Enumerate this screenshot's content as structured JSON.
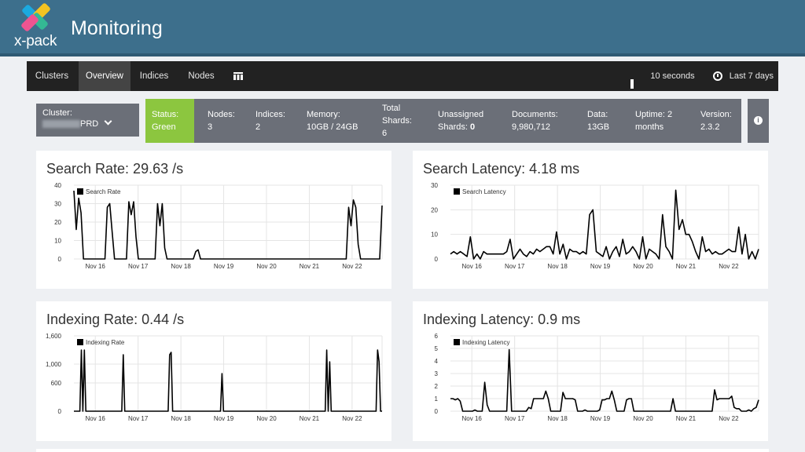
{
  "banner": {
    "title": "Monitoring",
    "logo_text": "x-pack",
    "logo_icon": "xpack-logo-icon",
    "bg_color": "#3d6f8c"
  },
  "nav": {
    "tabs": [
      {
        "label": "Clusters",
        "active": false
      },
      {
        "label": "Overview",
        "active": true
      },
      {
        "label": "Indices",
        "active": false
      },
      {
        "label": "Nodes",
        "active": false
      },
      {
        "label": "",
        "icon": "grid-icon",
        "active": false
      }
    ],
    "refresh_label": "10 seconds",
    "time_range_label": "Last 7 days"
  },
  "cluster": {
    "label": "Cluster:",
    "name_suffix": "PRD"
  },
  "status": {
    "status_label": "Status:",
    "status_value": "Green",
    "status_color": "#8cc63f",
    "nodes_label": "Nodes:",
    "nodes_value": "3",
    "indices_label": "Indices:",
    "indices_value": "2",
    "memory_label": "Memory:",
    "memory_value": "10GB / 24GB",
    "shards_label_1": "Total",
    "shards_label_2": "Shards:",
    "shards_value": "6",
    "unassigned_label": "Unassigned",
    "unassigned_label_2": "Shards:",
    "unassigned_value": "0",
    "documents_label": "Documents:",
    "documents_value": "9,980,712",
    "data_label": "Data:",
    "data_value": "13GB",
    "uptime_label": "Uptime: 2",
    "uptime_value": "months",
    "version_label": "Version:",
    "version_value": "2.3.2"
  },
  "chart_data": [
    {
      "type": "line",
      "title": "Search Rate: 29.63 /s",
      "series": [
        {
          "name": "Search Rate",
          "values": [
            37,
            16,
            33,
            25,
            0,
            0,
            0,
            0,
            0,
            0,
            0,
            0,
            0,
            0,
            28,
            30,
            15,
            0,
            0,
            0,
            0,
            0,
            0,
            31,
            24,
            31,
            12,
            0,
            0,
            0,
            0,
            0,
            0,
            0,
            0,
            30,
            18,
            30,
            6,
            0,
            0,
            0,
            0,
            0,
            0,
            0,
            0,
            0,
            0,
            0,
            0,
            4,
            5,
            0,
            0,
            0,
            0,
            0,
            0,
            0,
            0,
            0,
            0,
            0,
            0,
            0,
            0,
            0,
            0,
            0,
            0,
            0,
            0,
            0,
            0,
            0,
            0,
            0,
            0,
            0,
            0,
            0,
            0,
            0,
            0,
            0,
            0,
            0,
            0,
            0,
            0,
            0,
            0,
            0,
            0,
            0,
            0,
            0,
            0,
            0,
            0,
            0,
            0,
            0,
            0,
            0,
            0,
            0,
            0,
            0,
            0,
            0,
            0,
            0,
            0,
            28,
            18,
            32,
            28,
            8,
            0,
            0,
            0,
            0,
            0,
            0,
            0,
            0,
            0,
            29
          ]
        }
      ],
      "x_labels": [
        "Nov 16",
        "Nov 17",
        "Nov 18",
        "Nov 19",
        "Nov 20",
        "Nov 21",
        "Nov 22"
      ],
      "yticks": [
        "0",
        "10",
        "20",
        "30",
        "40"
      ],
      "ylim": [
        0,
        40
      ],
      "legend": "top-left"
    },
    {
      "type": "line",
      "title": "Search Latency: 4.18 ms",
      "series": [
        {
          "name": "Search Latency",
          "values": [
            2,
            3,
            2,
            3,
            2,
            1,
            9,
            0,
            2,
            0,
            3,
            2,
            2,
            2,
            2,
            2,
            2,
            3,
            8,
            0,
            2,
            4,
            2,
            1,
            3,
            2,
            4,
            3,
            4,
            5,
            5,
            2,
            11,
            2,
            6,
            0,
            4,
            3,
            3,
            2,
            3,
            2,
            18,
            20,
            3,
            2,
            1,
            5,
            0,
            3,
            5,
            1,
            8,
            2,
            3,
            5,
            3,
            0,
            9,
            0,
            4,
            3,
            2,
            0,
            18,
            5,
            3,
            0,
            28,
            12,
            16,
            10,
            10,
            7,
            3,
            0,
            9,
            3,
            4,
            2,
            3,
            2,
            2,
            3,
            4,
            3,
            3,
            13,
            2,
            10,
            0,
            3,
            0,
            4
          ]
        }
      ],
      "x_labels": [
        "Nov 16",
        "Nov 17",
        "Nov 18",
        "Nov 19",
        "Nov 20",
        "Nov 21",
        "Nov 22"
      ],
      "yticks": [
        "0",
        "10",
        "20",
        "30"
      ],
      "ylim": [
        0,
        30
      ],
      "legend": "top-left"
    },
    {
      "type": "line",
      "title": "Indexing Rate: 0.44 /s",
      "series": [
        {
          "name": "Indexing Rate",
          "values": [
            0,
            0,
            0,
            0,
            0,
            1300,
            0,
            1300,
            0,
            0,
            0,
            0,
            0,
            0,
            0,
            0,
            0,
            0,
            0,
            0,
            0,
            0,
            0,
            0,
            0,
            0,
            0,
            0,
            0,
            0,
            0,
            0,
            0,
            1200,
            0,
            0,
            0,
            0,
            0,
            0,
            0,
            0,
            0,
            0,
            0,
            0,
            0,
            0,
            0,
            0,
            0,
            0,
            0,
            0,
            0,
            0,
            0,
            0,
            0,
            0,
            0,
            0,
            0,
            0,
            1200,
            1250,
            0,
            0,
            0,
            0,
            0,
            0,
            0,
            0,
            0,
            0,
            0,
            0,
            0,
            0,
            0,
            0,
            0,
            0,
            0,
            0,
            0,
            0,
            0,
            0,
            0,
            0,
            0,
            0,
            0,
            0,
            0,
            0,
            0,
            800,
            0,
            0,
            0,
            0,
            0,
            0,
            0,
            0,
            0,
            0,
            0,
            0,
            0,
            0,
            0,
            0,
            0,
            0,
            0,
            0,
            0,
            0,
            0,
            0,
            0,
            0,
            0,
            0,
            0,
            0,
            0,
            0,
            0,
            0,
            0,
            0,
            0,
            0,
            0,
            0,
            0,
            0,
            0,
            0,
            0,
            0,
            0,
            0,
            0,
            0,
            0,
            0,
            0,
            0,
            0,
            0,
            0,
            0,
            0,
            0,
            0,
            0,
            0,
            0,
            0,
            0,
            0,
            0,
            0,
            1300,
            0,
            1050,
            0,
            0,
            0,
            0,
            0,
            0,
            0,
            0,
            0,
            0,
            0,
            0,
            0,
            0,
            0,
            0,
            0,
            0,
            0,
            0,
            0,
            0,
            0,
            0,
            0,
            0,
            0,
            0,
            0,
            0,
            0,
            1300,
            1050,
            0,
            0
          ]
        }
      ],
      "x_labels": [
        "Nov 16",
        "Nov 17",
        "Nov 18",
        "Nov 19",
        "Nov 20",
        "Nov 21",
        "Nov 22"
      ],
      "yticks": [
        "0",
        "600",
        "1,000",
        "1,600"
      ],
      "ylim": [
        0,
        1600
      ],
      "legend": "top-left"
    },
    {
      "type": "line",
      "title": "Indexing Latency: 0.9 ms",
      "series": [
        {
          "name": "Indexing Latency",
          "values": [
            1,
            1,
            0.9,
            1,
            0.8,
            0,
            0,
            0,
            0,
            0,
            0.1,
            0,
            0,
            0,
            2.3,
            0.5,
            0,
            0,
            0,
            0,
            0,
            0,
            0,
            0,
            4.9,
            0,
            0,
            0,
            0,
            0,
            0,
            0,
            0.3,
            0.2,
            1,
            1,
            1,
            1,
            1,
            1.6,
            1,
            0,
            0,
            0,
            0,
            0,
            1.5,
            1,
            1,
            1,
            1,
            0.9,
            0,
            0,
            0,
            0.1,
            0,
            0,
            0,
            0,
            0,
            0.1,
            0.9,
            0.9,
            1,
            1,
            1.6,
            0.9,
            0,
            0,
            0,
            0,
            0.9,
            1,
            1,
            0,
            0,
            0,
            0,
            0,
            0,
            0,
            0,
            0,
            0,
            0,
            0,
            0,
            0,
            0,
            0,
            1,
            0,
            0,
            0,
            0,
            0,
            0,
            0,
            0,
            0,
            0,
            0,
            0,
            0,
            0,
            0,
            0,
            1.7,
            0.9,
            1,
            1,
            1,
            1,
            1,
            1.2,
            0.3,
            0.2,
            0.2,
            0,
            0,
            0,
            0.1,
            0,
            0.2,
            0.3,
            0.9
          ]
        }
      ],
      "x_labels": [
        "Nov 16",
        "Nov 17",
        "Nov 18",
        "Nov 19",
        "Nov 20",
        "Nov 21",
        "Nov 22"
      ],
      "yticks": [
        "0",
        "1",
        "2",
        "3",
        "4",
        "5",
        "6"
      ],
      "ylim": [
        0,
        6
      ],
      "legend": "top-left"
    }
  ]
}
